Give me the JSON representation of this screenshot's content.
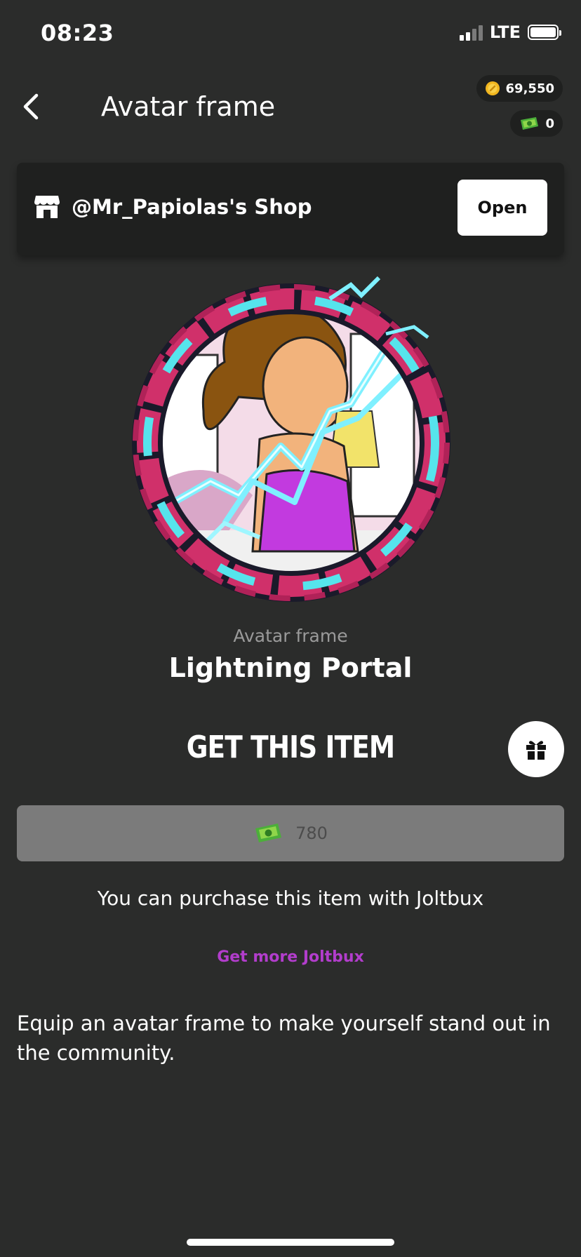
{
  "status_bar": {
    "time": "08:23",
    "network": "LTE"
  },
  "header": {
    "title": "Avatar frame",
    "coins": "69,550",
    "joltbux": "0"
  },
  "shop": {
    "name": "@Mr_Papiolas's Shop",
    "open_label": "Open"
  },
  "item": {
    "category": "Avatar frame",
    "name": "Lightning Portal"
  },
  "purchase": {
    "title": "GET THIS ITEM",
    "price": "780",
    "note": "You can purchase this item with Joltbux",
    "get_more_label": "Get more Joltbux"
  },
  "description": "Equip an avatar frame to make yourself stand out in the community.",
  "colors": {
    "background": "#2b2c2b",
    "panel": "#1f201f",
    "accent_link": "#b23dcc",
    "disabled_button": "#7b7b7b",
    "frame_ring": "#d0306a",
    "lightning": "#7ff0ff"
  },
  "icons": {
    "back": "chevron-left-icon",
    "coin": "gold-coin-icon",
    "joltbux": "joltbux-bill-icon",
    "shop": "storefront-icon",
    "gift": "gift-icon"
  }
}
